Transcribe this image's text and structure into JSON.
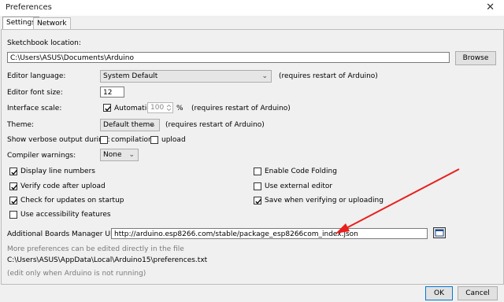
{
  "window": {
    "title": "Preferences",
    "close_glyph": "✕"
  },
  "tabs": [
    {
      "label": "Settings",
      "active": true
    },
    {
      "label": "Network",
      "active": false
    }
  ],
  "sketchbook": {
    "label": "Sketchbook location:",
    "value": "C:\\Users\\ASUS\\Documents\\Arduino",
    "browse_label": "Browse"
  },
  "editor_language": {
    "label": "Editor language:",
    "value": "System Default",
    "note": "(requires restart of Arduino)"
  },
  "editor_font_size": {
    "label": "Editor font size:",
    "value": "12"
  },
  "interface_scale": {
    "label": "Interface scale:",
    "automatic_label": "Automatic",
    "automatic_checked": true,
    "value": "100",
    "unit": "%",
    "note": "(requires restart of Arduino)"
  },
  "theme": {
    "label": "Theme:",
    "value": "Default theme",
    "note": "(requires restart of Arduino)"
  },
  "verbose": {
    "label": "Show verbose output during:",
    "compilation_label": "compilation",
    "compilation_checked": false,
    "upload_label": "upload",
    "upload_checked": false
  },
  "compiler_warnings": {
    "label": "Compiler warnings:",
    "value": "None"
  },
  "options_left": [
    {
      "label": "Display line numbers",
      "checked": true
    },
    {
      "label": "Verify code after upload",
      "checked": true
    },
    {
      "label": "Check for updates on startup",
      "checked": true
    },
    {
      "label": "Use accessibility features",
      "checked": false
    }
  ],
  "options_right": [
    {
      "label": "Enable Code Folding",
      "checked": false
    },
    {
      "label": "Use external editor",
      "checked": false
    },
    {
      "label": "Save when verifying or uploading",
      "checked": true
    }
  ],
  "boards_urls": {
    "label": "Additional Boards Manager URLs:",
    "value": "http://arduino.esp8266.com/stable/package_esp8266com_index.json",
    "icon": "window-icon"
  },
  "footer": {
    "more_prefs": "More preferences can be edited directly in the file",
    "prefs_path": "C:\\Users\\ASUS\\AppData\\Local\\Arduino15\\preferences.txt",
    "edit_note": "(edit only when Arduino is not running)"
  },
  "buttons": {
    "ok": "OK",
    "cancel": "Cancel"
  },
  "colors": {
    "annotation_arrow": "#e8201e"
  }
}
